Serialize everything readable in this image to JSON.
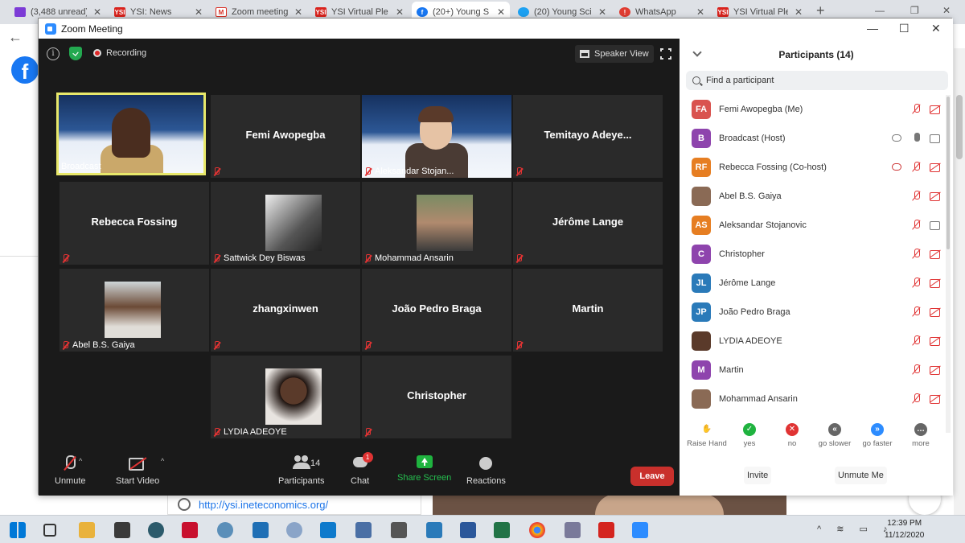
{
  "browser": {
    "tabs": [
      {
        "title": "(3,488 unread)",
        "icon": "mail-icon",
        "color": "#7c3bd6"
      },
      {
        "title": "YSI: News",
        "icon": "ysi-icon",
        "color": "#d9231d"
      },
      {
        "title": "Zoom meeting",
        "icon": "gmail-icon",
        "color": "#d93025"
      },
      {
        "title": "YSI Virtual Ple",
        "icon": "ysi-icon",
        "color": "#d9231d"
      },
      {
        "title": "(20+) Young S",
        "icon": "facebook-icon",
        "color": "#1877f2"
      },
      {
        "title": "(20) Young Sci",
        "icon": "twitter-icon",
        "color": "#1da1f2"
      },
      {
        "title": "WhatsApp",
        "icon": "whatsapp-icon",
        "color": "#e03c31"
      },
      {
        "title": "YSI Virtual Ple",
        "icon": "ysi-icon",
        "color": "#d9231d"
      }
    ],
    "url_text": "http://ysi.ineteconomics.org/"
  },
  "zoom": {
    "window_title": "Zoom Meeting",
    "recording_label": "Recording",
    "speaker_view_label": "Speaker View",
    "tiles": [
      {
        "name": "Broadcast",
        "type": "video",
        "active": true
      },
      {
        "name": "Femi Awopegba",
        "type": "name"
      },
      {
        "name": "Aleksandar Stojan...",
        "type": "video"
      },
      {
        "name": "Temitayo  Adeye...",
        "type": "name"
      },
      {
        "name": "Rebecca Fossing",
        "type": "name"
      },
      {
        "name": "Sattwick Dey Biswas",
        "type": "photo"
      },
      {
        "name": "Mohammad Ansarin",
        "type": "photo"
      },
      {
        "name": "Jérôme Lange",
        "type": "name"
      },
      {
        "name": "Abel B.S. Gaiya",
        "type": "photo"
      },
      {
        "name": "zhangxinwen",
        "type": "name"
      },
      {
        "name": "João Pedro Braga",
        "type": "name"
      },
      {
        "name": "Martin",
        "type": "name"
      },
      {
        "name": "LYDIA ADEOYE",
        "type": "photo"
      },
      {
        "name": "Christopher",
        "type": "name"
      }
    ],
    "toolbar": {
      "unmute": "Unmute",
      "start_video": "Start Video",
      "participants": "Participants",
      "participants_count": "14",
      "chat": "Chat",
      "chat_badge": "1",
      "share_screen": "Share Screen",
      "reactions": "Reactions",
      "leave": "Leave"
    },
    "panel": {
      "title": "Participants (14)",
      "search_placeholder": "Find a participant",
      "participants": [
        {
          "initials": "FA",
          "name": "Femi Awopegba (Me)",
          "color": "#d9534f",
          "mic": "muted",
          "cam": "off"
        },
        {
          "initials": "B",
          "name": "Broadcast (Host)",
          "color": "#8e44ad",
          "mic": "on",
          "cam": "on",
          "rec": true
        },
        {
          "initials": "RF",
          "name": "Rebecca Fossing (Co-host)",
          "color": "#e67e22",
          "mic": "muted",
          "cam": "off",
          "rec": true
        },
        {
          "initials": "",
          "name": "Abel B.S. Gaiya",
          "color": "#8a6a55",
          "mic": "muted",
          "cam": "off"
        },
        {
          "initials": "AS",
          "name": "Aleksandar Stojanovic",
          "color": "#e67e22",
          "mic": "muted",
          "cam": "on"
        },
        {
          "initials": "C",
          "name": "Christopher",
          "color": "#8e44ad",
          "mic": "muted",
          "cam": "off"
        },
        {
          "initials": "JL",
          "name": "Jérôme Lange",
          "color": "#2a7ab9",
          "mic": "muted",
          "cam": "off"
        },
        {
          "initials": "JP",
          "name": "João Pedro Braga",
          "color": "#2a7ab9",
          "mic": "muted",
          "cam": "off"
        },
        {
          "initials": "",
          "name": "LYDIA ADEOYE",
          "color": "#5a3a2a",
          "mic": "muted",
          "cam": "off"
        },
        {
          "initials": "M",
          "name": "Martin",
          "color": "#8e44ad",
          "mic": "muted",
          "cam": "off"
        },
        {
          "initials": "",
          "name": "Mohammad Ansarin",
          "color": "#8a6a55",
          "mic": "muted",
          "cam": "off"
        }
      ],
      "reactions": [
        {
          "label": "Raise Hand",
          "color": "#2d8cff"
        },
        {
          "label": "yes",
          "color": "#1fb33f"
        },
        {
          "label": "no",
          "color": "#e03333"
        },
        {
          "label": "go slower",
          "color": "#666666"
        },
        {
          "label": "go faster",
          "color": "#2d8cff"
        },
        {
          "label": "more",
          "color": "#666666"
        }
      ],
      "invite": "Invite",
      "unmute_me": "Unmute Me"
    }
  },
  "taskbar": {
    "time": "12:39 PM",
    "date": "11/12/2020"
  }
}
